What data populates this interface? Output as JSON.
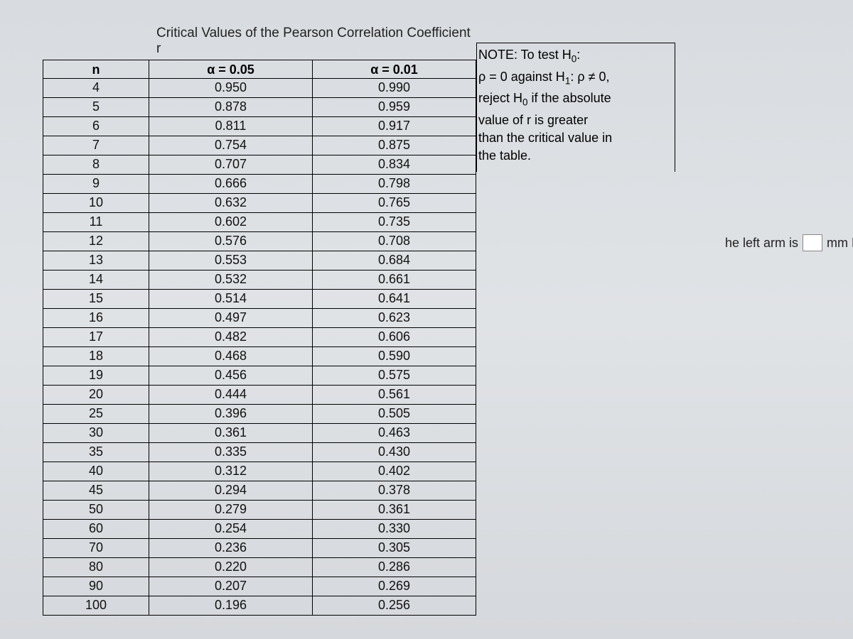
{
  "title": "Critical Values of the Pearson Correlation Coefficient r",
  "headers": {
    "n": "n",
    "alpha05": "α = 0.05",
    "alpha01": "α = 0.01"
  },
  "chart_data": {
    "type": "table",
    "columns": [
      "n",
      "α = 0.05",
      "α = 0.01"
    ],
    "rows": [
      {
        "n": "4",
        "a05": "0.950",
        "a01": "0.990"
      },
      {
        "n": "5",
        "a05": "0.878",
        "a01": "0.959"
      },
      {
        "n": "6",
        "a05": "0.811",
        "a01": "0.917"
      },
      {
        "n": "7",
        "a05": "0.754",
        "a01": "0.875"
      },
      {
        "n": "8",
        "a05": "0.707",
        "a01": "0.834"
      },
      {
        "n": "9",
        "a05": "0.666",
        "a01": "0.798"
      },
      {
        "n": "10",
        "a05": "0.632",
        "a01": "0.765"
      },
      {
        "n": "11",
        "a05": "0.602",
        "a01": "0.735"
      },
      {
        "n": "12",
        "a05": "0.576",
        "a01": "0.708"
      },
      {
        "n": "13",
        "a05": "0.553",
        "a01": "0.684"
      },
      {
        "n": "14",
        "a05": "0.532",
        "a01": "0.661"
      },
      {
        "n": "15",
        "a05": "0.514",
        "a01": "0.641"
      },
      {
        "n": "16",
        "a05": "0.497",
        "a01": "0.623"
      },
      {
        "n": "17",
        "a05": "0.482",
        "a01": "0.606"
      },
      {
        "n": "18",
        "a05": "0.468",
        "a01": "0.590"
      },
      {
        "n": "19",
        "a05": "0.456",
        "a01": "0.575"
      },
      {
        "n": "20",
        "a05": "0.444",
        "a01": "0.561"
      },
      {
        "n": "25",
        "a05": "0.396",
        "a01": "0.505"
      },
      {
        "n": "30",
        "a05": "0.361",
        "a01": "0.463"
      },
      {
        "n": "35",
        "a05": "0.335",
        "a01": "0.430"
      },
      {
        "n": "40",
        "a05": "0.312",
        "a01": "0.402"
      },
      {
        "n": "45",
        "a05": "0.294",
        "a01": "0.378"
      },
      {
        "n": "50",
        "a05": "0.279",
        "a01": "0.361"
      },
      {
        "n": "60",
        "a05": "0.254",
        "a01": "0.330"
      },
      {
        "n": "70",
        "a05": "0.236",
        "a01": "0.305"
      },
      {
        "n": "80",
        "a05": "0.220",
        "a01": "0.286"
      },
      {
        "n": "90",
        "a05": "0.207",
        "a01": "0.269"
      },
      {
        "n": "100",
        "a05": "0.196",
        "a01": "0.256"
      }
    ]
  },
  "note": {
    "line1_prefix": "NOTE: To test H",
    "line1_sub": "0",
    "line1_suffix": ":",
    "line2_prefix": "ρ = 0 against H",
    "line2_sub": "1",
    "line2_suffix": ": ρ ≠ 0,",
    "line3_prefix": "reject H",
    "line3_sub": "0",
    "line3_suffix": " if the absolute",
    "line4": "value of r is greater",
    "line5": "than the critical value in",
    "line6": "the table."
  },
  "background": {
    "prefix": "he left arm is",
    "suffix": "mm Hg"
  }
}
